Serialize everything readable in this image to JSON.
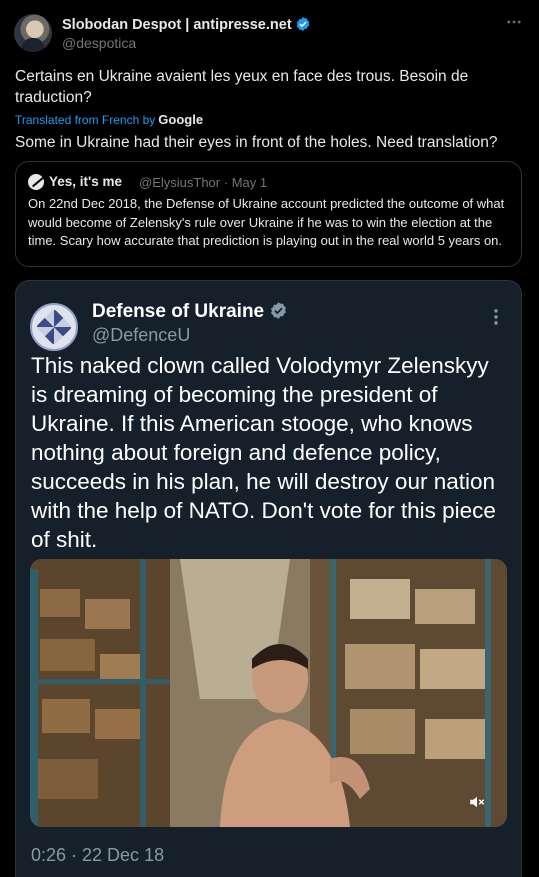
{
  "tweet": {
    "author_name": "Slobodan Despot | antipresse.net",
    "author_handle": "@despotica",
    "more_icon": "more-horizontal-icon",
    "text": "Certains en Ukraine avaient les yeux en face des trous. Besoin de traduction?",
    "translated_label": "Translated from French by",
    "translated_brand": "Google",
    "translated_text": "Some in Ukraine had their eyes in front of the holes. Need translation?"
  },
  "quote": {
    "author_name": "Yes, it's me",
    "author_handle": "@ElysiusThor",
    "separator": "·",
    "date": "May 1",
    "text": "On 22nd Dec 2018, the Defense of Ukraine account predicted the outcome of what would become of Zelensky's rule over Ukraine if he was to win the election at the time. Scary how accurate that prediction is playing out in the real world 5 years on."
  },
  "embedded": {
    "author_name": "Defense of Ukraine",
    "author_handle": "@DefenceU",
    "text": "This naked clown called Volodymyr Zelenskyy is dreaming of becoming the president of Ukraine. If this American stooge, who knows nothing about foreign and defence policy, succeeds in his plan, he will destroy our nation with the help of NATO. Don't vote for this piece of shit.",
    "video_icon": "muted-speaker-icon",
    "video_timestamp": "0:26 · 22 Dec 18"
  },
  "colors": {
    "accent": "#1d9bf0",
    "background": "#000000",
    "secondary_text": "#71767b",
    "embedded_bg": "#15202b"
  }
}
